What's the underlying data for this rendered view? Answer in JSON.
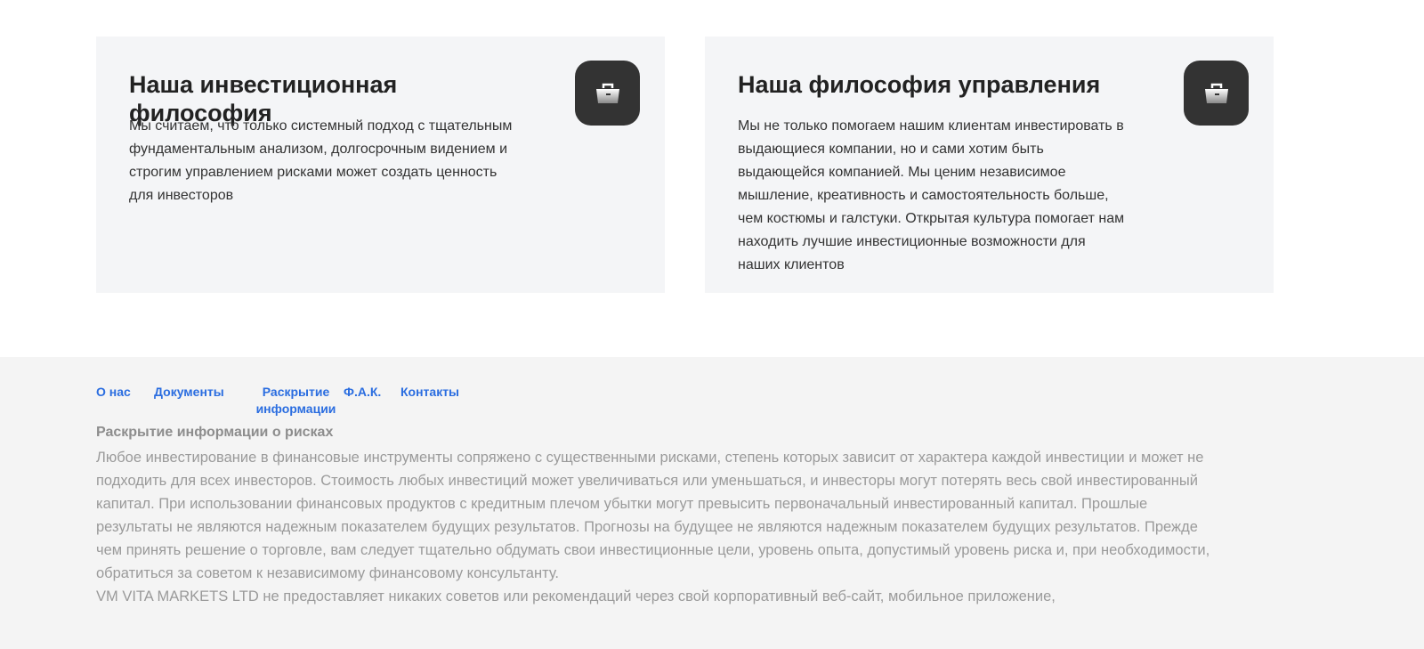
{
  "cards": [
    {
      "title": "Наша инвестиционная философия",
      "text": "Мы считаем, что только системный подход с тщательным фундаментальным анализом, долгосрочным видением и строгим управлением рисками может создать ценность для инвесторов",
      "icon": "briefcase-icon"
    },
    {
      "title": "Наша философия управления",
      "text": "Мы не только помогаем нашим клиентам инвестировать в выдающиеся компании, но и сами хотим быть выдающейся компанией. Мы ценим независимое мышление, креативность и самостоятельность больше, чем костюмы и галстуки. Открытая культура помогает нам находить лучшие инвестиционные возможности для наших клиентов",
      "icon": "briefcase-icon"
    }
  ],
  "footer": {
    "nav": [
      "О нас",
      "Документы",
      "Раскрытие информации",
      "Ф.А.К.",
      "Контакты"
    ],
    "risk_title": "Раскрытие информации о рисках",
    "risk_text": "Любое инвестирование в финансовые инструменты сопряжено с существенными рисками, степень которых зависит от характера каждой инвестиции и может не подходить для всех инвесторов. Стоимость любых инвестиций может увеличиваться или уменьшаться, и инвесторы могут потерять весь свой инвестированный капитал. При использовании финансовых продуктов с кредитным плечом убытки могут превысить первоначальный инвестированный капитал. Прошлые результаты не являются надежным показателем будущих результатов. Прогнозы на будущее не являются надежным показателем будущих результатов. Прежде чем принять решение о торговле, вам следует тщательно обдумать свои инвестиционные цели, уровень опыта, допустимый уровень риска и, при необходимости, обратиться за советом к независимому финансовому консультанту.",
    "company_text": "VM VITA MARKETS LTD не предоставляет никаких советов или рекомендаций через свой корпоративный веб-сайт, мобильное приложение,"
  }
}
